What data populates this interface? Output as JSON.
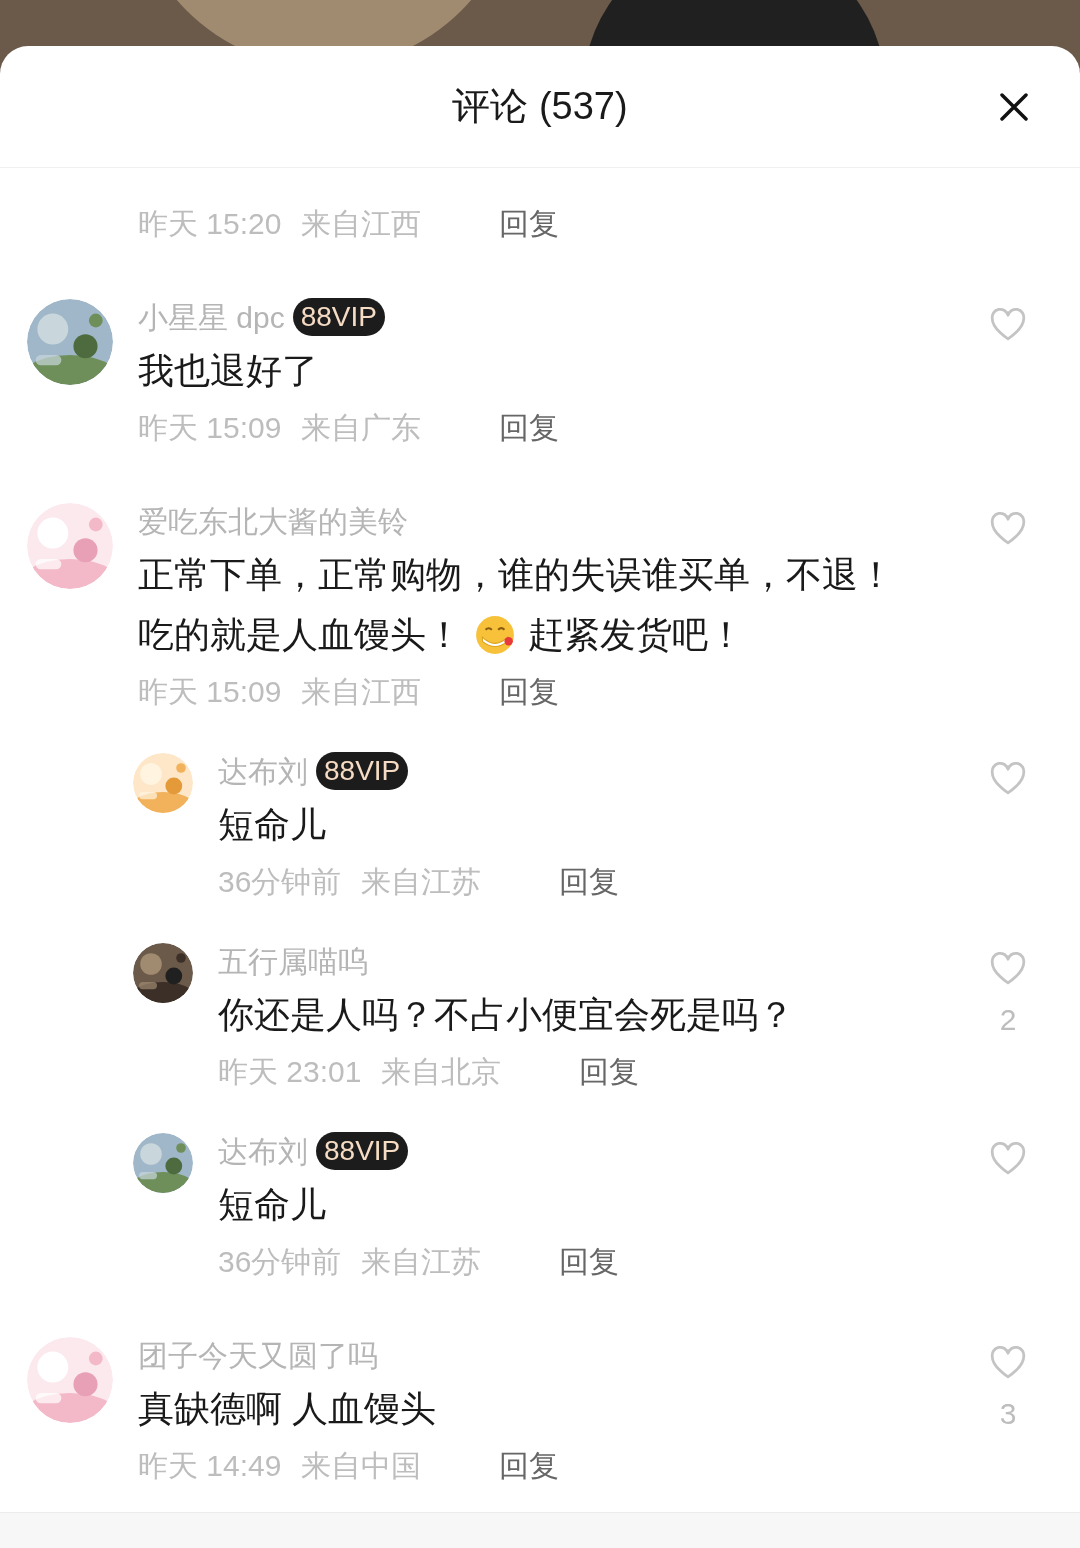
{
  "sheet": {
    "title": "评论 (537)"
  },
  "comments": [
    {
      "kind": "comment",
      "time": "昨天 15:20",
      "location": "来自江西",
      "reply": "回复"
    },
    {
      "kind": "comment",
      "name": "小星星 dpc",
      "vip": "88VIP",
      "lines": [
        [
          {
            "kind": "text",
            "text": "我也退好了"
          }
        ]
      ],
      "time": "昨天 15:09",
      "location": "来自广东",
      "reply": "回复",
      "liked": false
    },
    {
      "kind": "comment",
      "name": "爱吃东北大酱的美铃",
      "lines": [
        [
          {
            "kind": "text",
            "text": "正常下单，正常购物，谁的失误谁买单，不退！"
          }
        ],
        [
          {
            "kind": "text",
            "text": "吃的就是人血馒头！"
          },
          {
            "kind": "emoji"
          },
          {
            "kind": "text",
            "text": "赶紧发货吧！"
          }
        ]
      ],
      "time": "昨天 15:09",
      "location": "来自江西",
      "reply": "回复",
      "liked": false
    },
    {
      "kind": "reply",
      "name": "达布刘",
      "vip": "88VIP",
      "lines": [
        [
          {
            "kind": "text",
            "text": "短命儿"
          }
        ]
      ],
      "time": "36分钟前",
      "location": "来自江苏",
      "reply": "回复",
      "liked": false
    },
    {
      "kind": "reply",
      "name": "五行属喵呜",
      "lines": [
        [
          {
            "kind": "text",
            "text": "你还是人吗？不占小便宜会死是吗？"
          }
        ]
      ],
      "time": "昨天 23:01",
      "location": "来自北京",
      "reply": "回复",
      "liked": false,
      "likes": "2"
    },
    {
      "kind": "reply",
      "name": "达布刘",
      "vip": "88VIP",
      "lines": [
        [
          {
            "kind": "text",
            "text": "短命儿"
          }
        ]
      ],
      "time": "36分钟前",
      "location": "来自江苏",
      "reply": "回复",
      "liked": false
    },
    {
      "kind": "comment",
      "name": "团子今天又圆了吗",
      "lines": [
        [
          {
            "kind": "text",
            "text": "真缺德啊 人血馒头"
          }
        ]
      ],
      "time": "昨天 14:49",
      "location": "来自中国",
      "reply": "回复",
      "liked": false,
      "likes": "3"
    }
  ]
}
